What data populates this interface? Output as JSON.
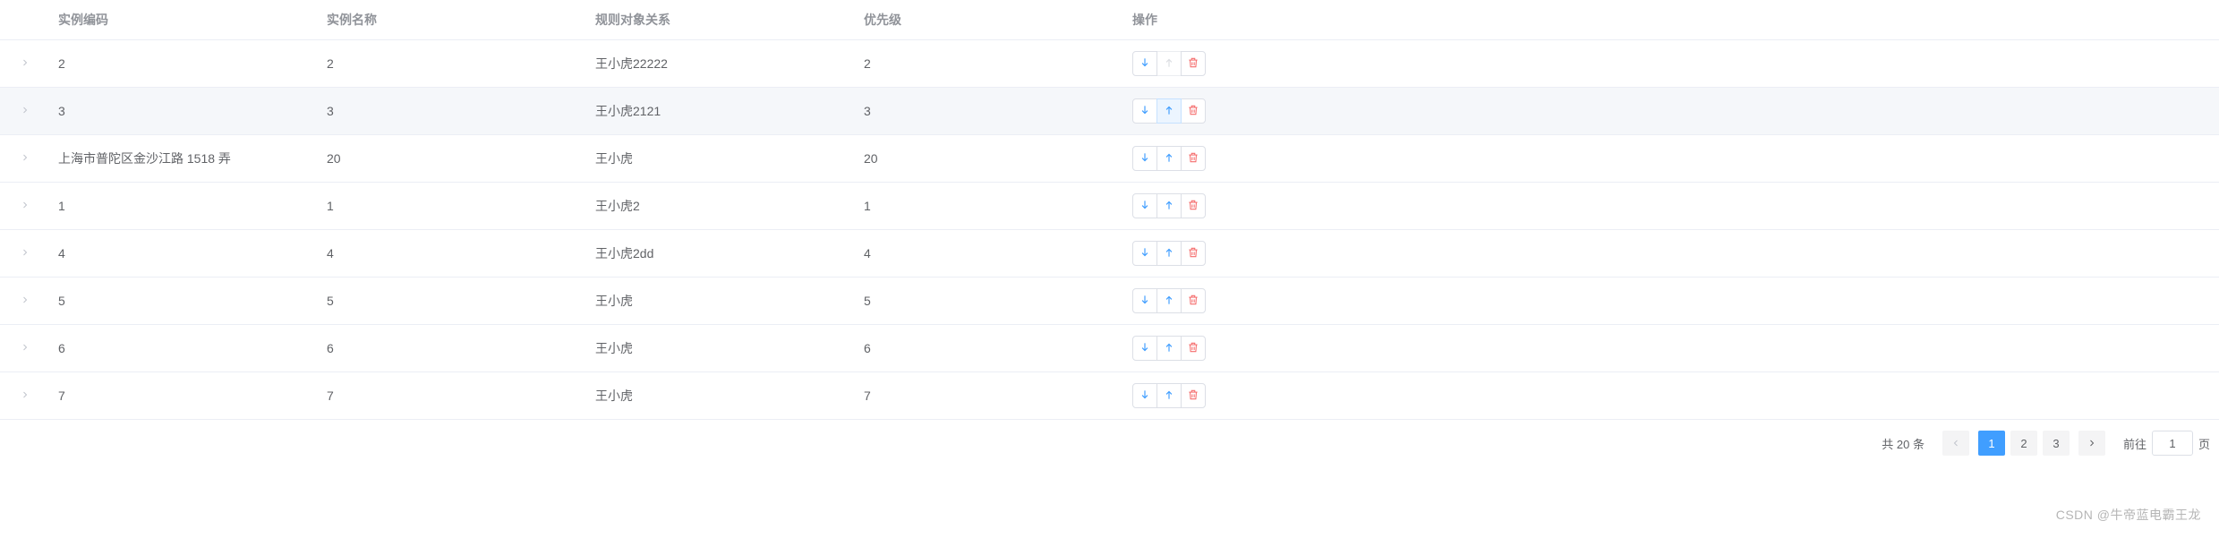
{
  "table": {
    "headers": {
      "code": "实例编码",
      "name": "实例名称",
      "relation": "规则对象关系",
      "priority": "优先级",
      "ops": "操作"
    },
    "rows": [
      {
        "code": "2",
        "name": "2",
        "relation": "王小虎22222",
        "priority": "2",
        "highlight": false,
        "up_disabled": true,
        "down_disabled": false
      },
      {
        "code": "3",
        "name": "3",
        "relation": "王小虎2121",
        "priority": "3",
        "highlight": true,
        "up_disabled": false,
        "down_disabled": false,
        "up_hover": true
      },
      {
        "code": "上海市普陀区金沙江路 1518 弄",
        "name": "20",
        "relation": "王小虎",
        "priority": "20",
        "highlight": false,
        "up_disabled": false,
        "down_disabled": false
      },
      {
        "code": "1",
        "name": "1",
        "relation": "王小虎2",
        "priority": "1",
        "highlight": false,
        "up_disabled": false,
        "down_disabled": false
      },
      {
        "code": "4",
        "name": "4",
        "relation": "王小虎2dd",
        "priority": "4",
        "highlight": false,
        "up_disabled": false,
        "down_disabled": false
      },
      {
        "code": "5",
        "name": "5",
        "relation": "王小虎",
        "priority": "5",
        "highlight": false,
        "up_disabled": false,
        "down_disabled": false
      },
      {
        "code": "6",
        "name": "6",
        "relation": "王小虎",
        "priority": "6",
        "highlight": false,
        "up_disabled": false,
        "down_disabled": false
      },
      {
        "code": "7",
        "name": "7",
        "relation": "王小虎",
        "priority": "7",
        "highlight": false,
        "up_disabled": false,
        "down_disabled": false
      }
    ]
  },
  "pagination": {
    "total_label": "共 20 条",
    "pages": [
      "1",
      "2",
      "3"
    ],
    "current_page": "1",
    "jump_prefix": "前往",
    "jump_suffix": "页",
    "jump_value": "1"
  },
  "watermark": "CSDN @牛帝蓝电霸王龙"
}
